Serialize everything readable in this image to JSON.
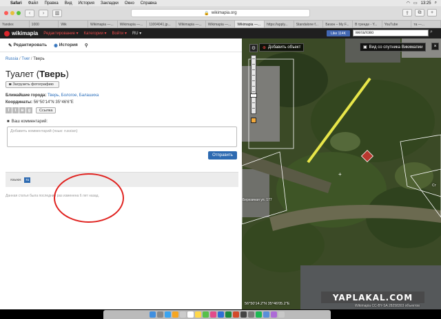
{
  "menubar": {
    "items": [
      "Safari",
      "Файл",
      "Правка",
      "Вид",
      "История",
      "Закладки",
      "Окно",
      "Справка"
    ],
    "time": "13:25"
  },
  "browser": {
    "url": "wikimapia.org",
    "tabs": [
      {
        "label": "Yandex"
      },
      {
        "label": "1000"
      },
      {
        "label": "Wik"
      },
      {
        "label": "Wikimapia —..."
      },
      {
        "label": "Wikimapia —..."
      },
      {
        "label": "11004041.jp..."
      },
      {
        "label": "Wikimapia —..."
      },
      {
        "label": "Wikimapia —..."
      },
      {
        "label": "Wikimapia —...",
        "active": true
      },
      {
        "label": "https://apply..."
      },
      {
        "label": "Standalone f..."
      },
      {
        "label": "Бизон – My F..."
      },
      {
        "label": "В тренде - Y..."
      },
      {
        "label": "YouTube"
      },
      {
        "label": "та —..."
      }
    ]
  },
  "wm_header": {
    "logo": "wikimapia",
    "menu_edit": "Редактирование ▾",
    "menu_categories": "Категории ▾",
    "menu_login": "Войти ▾",
    "lang": "RU ▾",
    "like": "Like 114K",
    "search_value": "мегалово"
  },
  "panel": {
    "tool_edit": "Редактировать",
    "tool_history": "История",
    "breadcrumb": [
      "Russia",
      "Tver",
      "Тверь"
    ],
    "title_main": "Туалет (",
    "title_bold": "Тверь",
    "title_end": ")",
    "upload_btn": "Загрузить фотографию",
    "nearest_label": "Ближайшие города:",
    "nearest_value": "Тверь, Бологое, Балашиха",
    "coords_label": "Координаты:",
    "coords_value": "56°50'14\"N 35°46'6\"E",
    "share_link": "Ссылка",
    "comment_label": "Ваш комментарий:",
    "comment_placeholder": "Добавить комментарий (язык: russian)",
    "send_btn": "Отправить",
    "lang_label": "языки:",
    "lang_chip": "ru",
    "edited_note": "Данная статья была последний раз изменена 6 лет назад."
  },
  "map": {
    "add_object": "Добавить объект",
    "sat_view": "Вид со спутника Викимапии",
    "label_road": "Березиная ул. 177",
    "label_ctr": "Ст",
    "coords": "56°50'14.2\"N 35°46'05.2\"E",
    "copyright": "Wikimapia CC-BY-SA   28258303 объектов"
  },
  "watermark": "YAPLAKAL.COM",
  "colors": {
    "wm_red": "#d9262c",
    "accent_blue": "#2d6ab1",
    "highlight_yellow": "#e8e64a",
    "annotation_red": "#e0221f"
  }
}
